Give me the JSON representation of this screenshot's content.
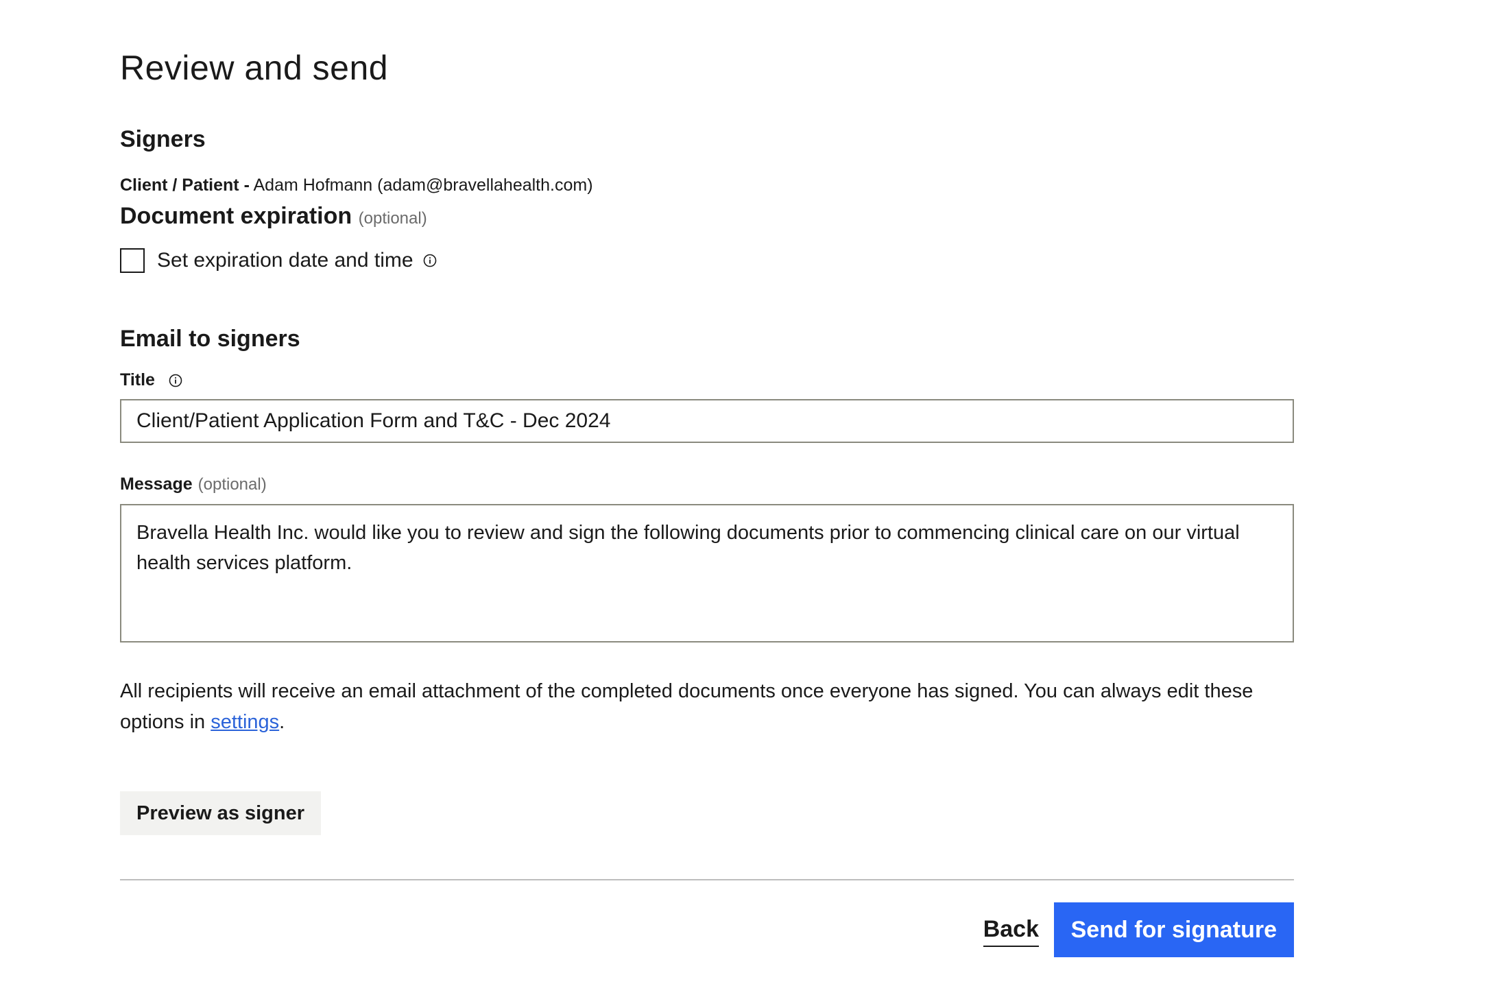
{
  "page": {
    "title": "Review and send"
  },
  "signers": {
    "heading": "Signers",
    "items": [
      {
        "role": "Client / Patient -",
        "name_email": "Adam Hofmann (adam@bravellahealth.com)"
      }
    ]
  },
  "expiration": {
    "heading": "Document expiration",
    "optional_tag": "(optional)",
    "checkbox_label": "Set expiration date and time",
    "checked": false,
    "info_icon": "info-icon"
  },
  "email": {
    "heading": "Email to signers",
    "title_label": "Title",
    "title_value": "Client/Patient Application Form and T&C - Dec 2024",
    "message_label": "Message",
    "message_optional_tag": "(optional)",
    "message_value": "Bravella Health Inc. would like you to review and sign the following documents prior to commencing clinical care on our virtual health services platform."
  },
  "notice": {
    "text_before": "All recipients will receive an email attachment of the completed documents once everyone has signed. You can always edit these options in ",
    "link_text": "settings",
    "text_after": "."
  },
  "actions": {
    "preview_label": "Preview as signer",
    "back_label": "Back",
    "send_label": "Send for signature"
  },
  "colors": {
    "primary": "#2966f4",
    "link": "#2b63d9",
    "secondary_button_bg": "#f2f2f0",
    "input_border": "#8a8a7e"
  }
}
